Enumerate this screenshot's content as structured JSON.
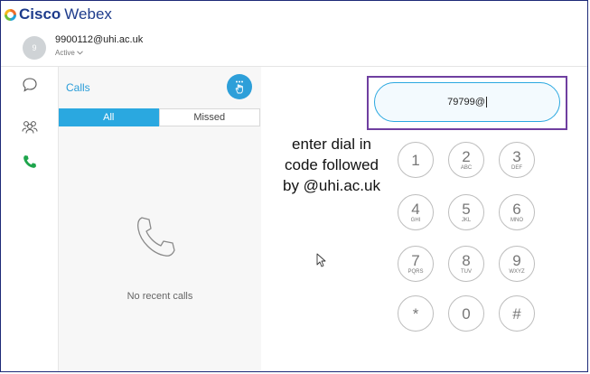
{
  "app": {
    "brand_bold": "Cisco",
    "brand_rest": "Webex"
  },
  "user": {
    "avatar_initial": "9",
    "email": "9900112@uhi.ac.uk",
    "status": "Active"
  },
  "sidebar": {
    "items": [
      {
        "name": "messaging",
        "icon": "chat-bubble-icon"
      },
      {
        "name": "teams",
        "icon": "people-icon"
      },
      {
        "name": "calls",
        "icon": "phone-icon",
        "active": true
      }
    ]
  },
  "calls_panel": {
    "title": "Calls",
    "tabs": [
      {
        "label": "All",
        "selected": true
      },
      {
        "label": "Missed",
        "selected": false
      }
    ],
    "empty_text": "No recent calls"
  },
  "dialer": {
    "input_value": "79799@",
    "keys": [
      {
        "digit": "1",
        "letters": ""
      },
      {
        "digit": "2",
        "letters": "ABC"
      },
      {
        "digit": "3",
        "letters": "DEF"
      },
      {
        "digit": "4",
        "letters": "GHI"
      },
      {
        "digit": "5",
        "letters": "JKL"
      },
      {
        "digit": "6",
        "letters": "MNO"
      },
      {
        "digit": "7",
        "letters": "PQRS"
      },
      {
        "digit": "8",
        "letters": "TUV"
      },
      {
        "digit": "9",
        "letters": "WXYZ"
      },
      {
        "digit": "*",
        "letters": ""
      },
      {
        "digit": "0",
        "letters": ""
      },
      {
        "digit": "#",
        "letters": ""
      }
    ]
  },
  "annotation": {
    "lines": [
      "enter dial in",
      "code followed",
      "by @uhi.ac.uk"
    ]
  },
  "colors": {
    "accent": "#2aa8e0",
    "brand_blue": "#1e3c8c",
    "highlight_box": "#6f3fa0",
    "active_call_icon": "#1ea54c"
  }
}
